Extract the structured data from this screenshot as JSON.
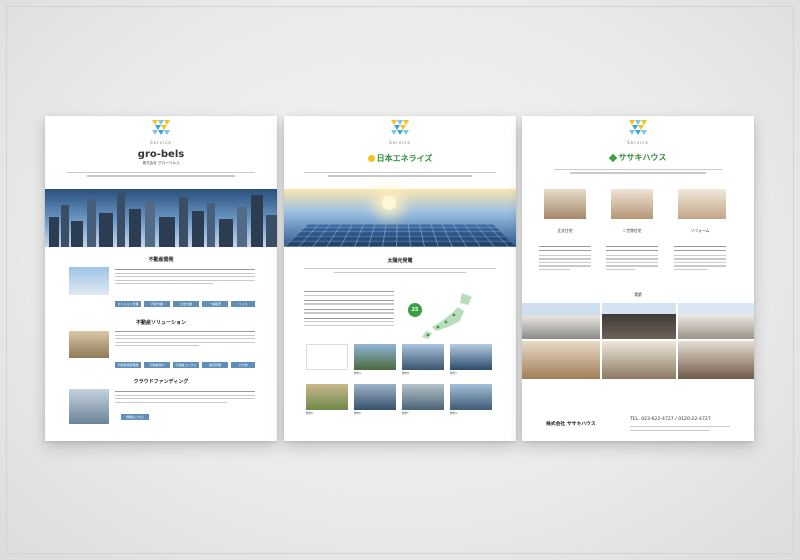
{
  "sheets": [
    {
      "service_label": "Service",
      "logo_text": "gro-bels",
      "company_name": "株式会社 グローベルス",
      "sections": [
        {
          "title": "不動産開発",
          "buttons": [
            "マンション分譲",
            "戸建分譲",
            "土地分譲",
            "一棟販売",
            "リノベ"
          ]
        },
        {
          "title": "不動産ソリューション",
          "buttons": [
            "不動産買取再販",
            "不動産仲介",
            "不動産コンサル",
            "賃貸管理",
            "その他"
          ]
        },
        {
          "title": "クラウドファンディング",
          "buttons": [
            "詳細はこちら"
          ]
        }
      ]
    },
    {
      "service_label": "Service",
      "logo_text": "日本エネライズ",
      "sections": [
        {
          "title": "太陽光発電"
        }
      ],
      "map_badge": "25",
      "captions": [
        "物件A",
        "物件B",
        "物件C",
        "物件D",
        "物件E",
        "物件F",
        "物件G",
        "物件H"
      ]
    },
    {
      "service_label": "Service",
      "logo_text": "ササキハウス",
      "columns": [
        "注文住宅",
        "二世帯住宅",
        "リフォーム"
      ],
      "gallery_title": "実績",
      "company_name": "株式会社 ササキハウス",
      "phone": "TEL. 023-622-4727 / 0120-22-4727"
    }
  ],
  "colors": {
    "accent_blue": "#5f8fb9",
    "logo_green": "#3aa043",
    "logo_yellow": "#f4c21a"
  }
}
